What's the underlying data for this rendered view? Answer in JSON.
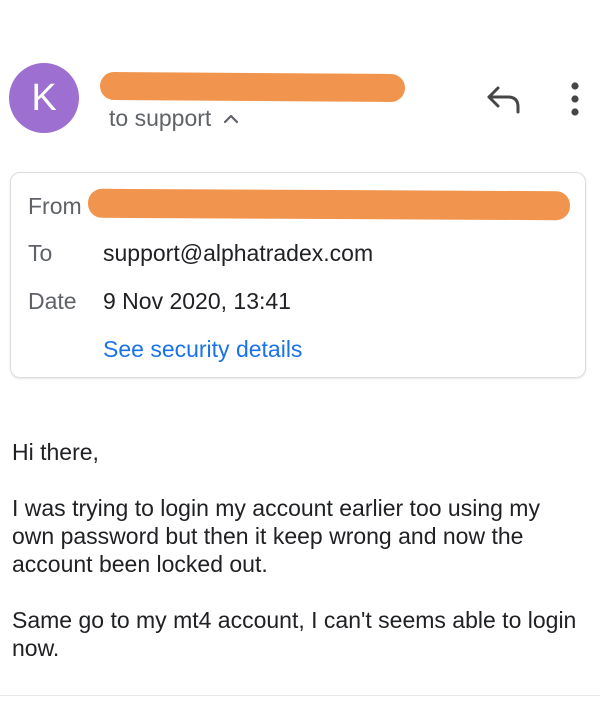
{
  "header": {
    "avatar_letter": "K",
    "avatar_color": "#9c6fd0",
    "recipient_line": "to support",
    "icons": [
      "reply-icon",
      "more-vert-icon",
      "chevron-up-icon"
    ]
  },
  "details": {
    "from_label": "From",
    "to_label": "To",
    "to_value": "support@alphatradex.com",
    "date_label": "Date",
    "date_value": "9 Nov 2020, 13:41",
    "security_link": "See security details"
  },
  "message": {
    "greeting": "Hi there,",
    "paragraph_1": "I was trying to login my account earlier too using my own password but then it keep wrong and now the account been locked out.",
    "paragraph_2": "Same go to my mt4 account, I can't seems able to login now."
  },
  "colors": {
    "redaction": "#f1944d",
    "link": "#1a73e8"
  }
}
